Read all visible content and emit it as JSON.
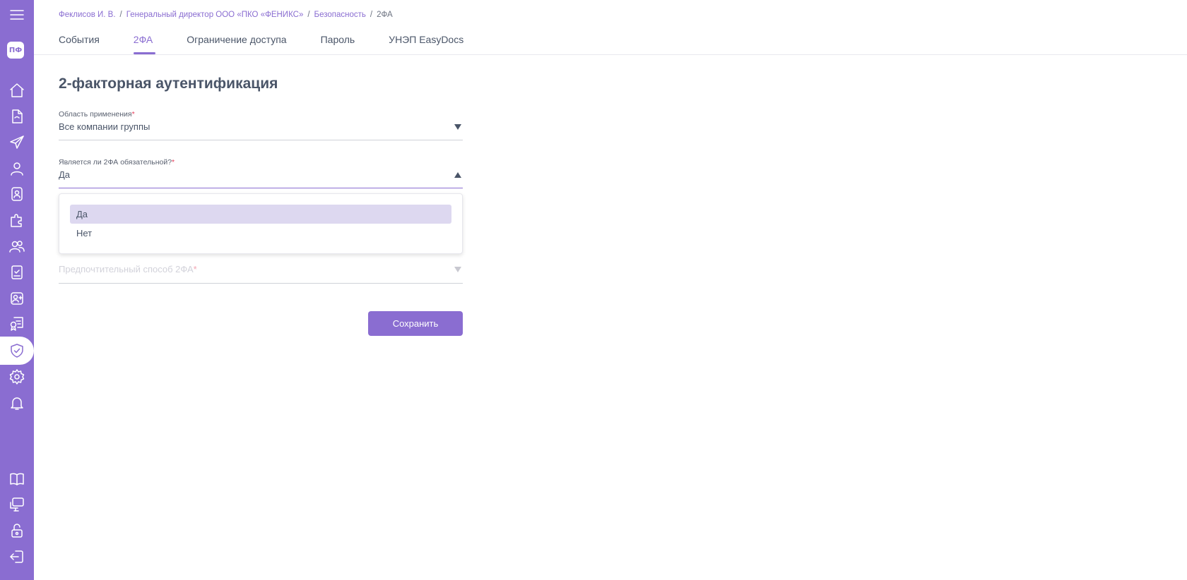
{
  "sidebar": {
    "avatar": "ПФ",
    "items": [
      {
        "icon": "menu-icon"
      },
      {
        "icon": "home-icon"
      },
      {
        "icon": "document-icon"
      },
      {
        "icon": "send-icon"
      },
      {
        "icon": "user-icon"
      },
      {
        "icon": "badge-icon"
      },
      {
        "icon": "puzzle-icon"
      },
      {
        "icon": "users-icon"
      },
      {
        "icon": "book-check-icon"
      },
      {
        "icon": "user-add-icon"
      },
      {
        "icon": "certificate-icon"
      },
      {
        "icon": "shield-check-icon",
        "active": true
      },
      {
        "icon": "gear-icon"
      },
      {
        "icon": "bell-icon"
      },
      {
        "icon": "open-book-icon"
      },
      {
        "icon": "monitor-chat-icon"
      },
      {
        "icon": "unlock-icon"
      },
      {
        "icon": "logout-icon"
      }
    ],
    "accent": "#8a6dd1"
  },
  "breadcrumb": {
    "items": [
      "Феклисов И. В.",
      "Генеральный директор ООО «ПКО «ФЕНИКС»",
      "Безопасность"
    ],
    "current": "2ФА"
  },
  "tabs": [
    {
      "label": "События"
    },
    {
      "label": "2ФА",
      "active": true
    },
    {
      "label": "Ограничение доступа"
    },
    {
      "label": "Пароль"
    },
    {
      "label": "УНЭП EasyDocs"
    }
  ],
  "page": {
    "title": "2-факторная аутентификация"
  },
  "form": {
    "scope": {
      "label": "Область применения",
      "required_mark": "*",
      "value": "Все компании группы"
    },
    "mandatory": {
      "label": "Является ли 2ФА обязательной?",
      "required_mark": "*",
      "value": "Да",
      "options": [
        "Да",
        "Нет"
      ],
      "selected": "Да"
    },
    "method": {
      "placeholder": "Предпочтительный способ 2ФА",
      "required_mark": "*"
    },
    "save_label": "Сохранить"
  }
}
